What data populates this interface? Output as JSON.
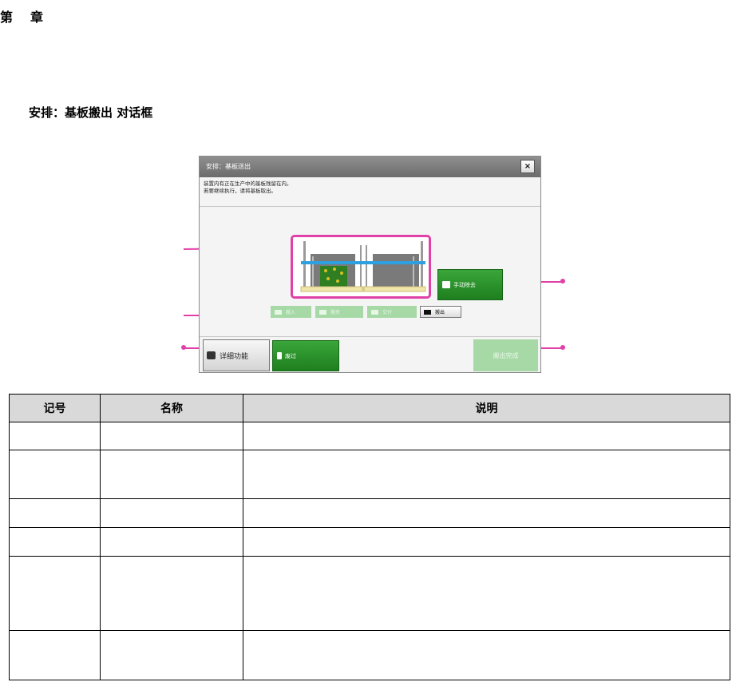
{
  "header": {
    "chapter_prefix": "第",
    "chapter_suffix": "章",
    "section_title": "安排：基板搬出 对话框"
  },
  "dialog": {
    "title": "安排：基板送出",
    "close_label": "×",
    "message_lines": [
      "装置内有正在生产中的基板残留在内。",
      "若要继续执行，请将基板取出。"
    ],
    "steps": [
      {
        "label": "搬入",
        "state": "disabled"
      },
      {
        "label": "搬夹",
        "state": "disabled"
      },
      {
        "label": "交付",
        "state": "disabled"
      },
      {
        "label": "搬出",
        "state": "active"
      }
    ],
    "manual_remove_label": "手动除去",
    "detail_label": "详细功能",
    "discard_label": "废过",
    "complete_label": "搬出完成",
    "colors": {
      "highlight": "#e040a8",
      "primary_green": "#2a942a",
      "disabled_green": "#a6d9a6",
      "rail_blue": "#2ea0e0"
    },
    "icons": {
      "detail": "settings-icon",
      "manual_remove": "manual-icon",
      "discard": "discard-icon",
      "step": "step-icon"
    }
  },
  "table": {
    "headers": [
      "记号",
      "名称",
      "说明"
    ],
    "rows": [
      [
        "",
        "",
        ""
      ],
      [
        "",
        "",
        ""
      ],
      [
        "",
        "",
        ""
      ],
      [
        "",
        "",
        ""
      ],
      [
        "",
        "",
        ""
      ],
      [
        "",
        "",
        ""
      ]
    ]
  }
}
